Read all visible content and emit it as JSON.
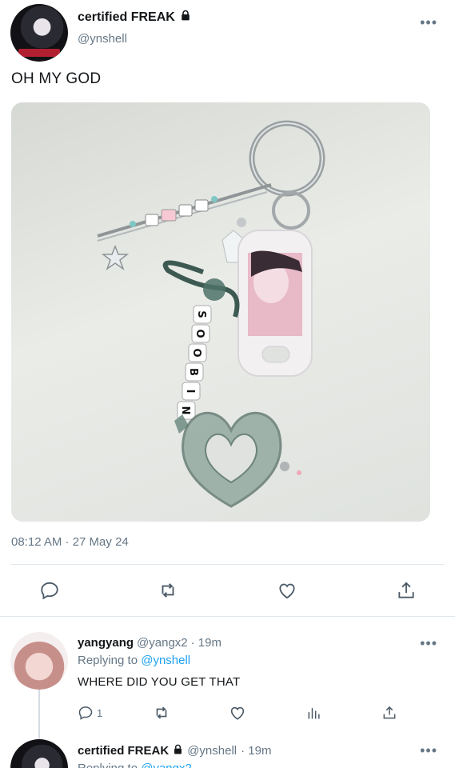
{
  "tweet": {
    "author_name": "certified FREAK",
    "author_handle": "@ynshell",
    "text": "OH MY GOD",
    "timestamp": "08:12 AM · 27 May 24",
    "more_glyph": "•••"
  },
  "media": {
    "bead_letters": [
      "S",
      "O",
      "O",
      "B",
      "I",
      "N"
    ]
  },
  "actions": {
    "reply_icon": "reply-icon",
    "retweet_icon": "retweet-icon",
    "like_icon": "heart-icon",
    "share_icon": "share-icon"
  },
  "replies": [
    {
      "name": "yangyang",
      "handle": "@yangx2",
      "time": "· 19m",
      "replying_prefix": "Replying to",
      "replying_to": "@ynshell",
      "text": "WHERE DID YOU GET THAT",
      "reply_count": "1"
    },
    {
      "name": "certified FREAK",
      "handle": "@ynshell",
      "time": "· 19m",
      "replying_prefix": "Replying to",
      "replying_to": "@yangx2"
    }
  ],
  "colors": {
    "text": "#14171a",
    "muted": "#657786",
    "link": "#1da1f2",
    "divider": "#e1e8ed"
  }
}
